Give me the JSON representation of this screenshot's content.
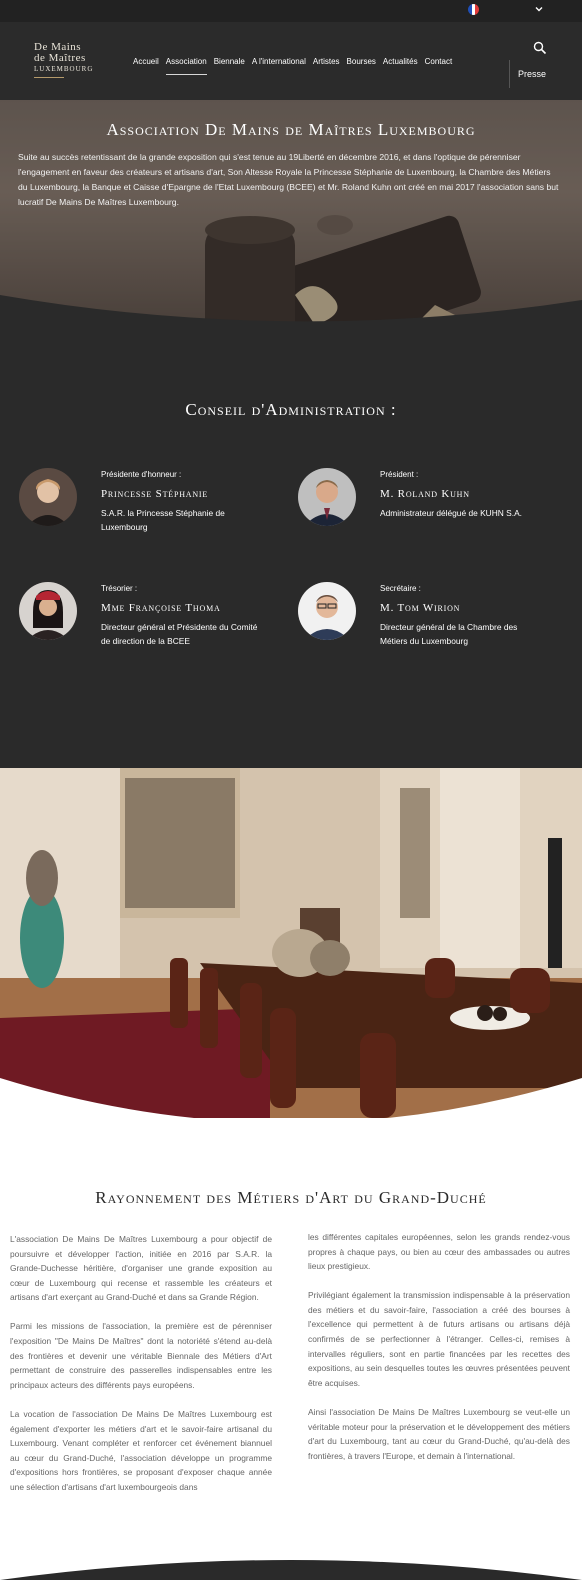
{
  "topbar": {
    "language_flag": "french-flag-icon",
    "dropdown_icon": "chevron-down-icon"
  },
  "header": {
    "logo": {
      "line1": "De Mains",
      "line2": "de Maîtres",
      "line3": "LUXEMBOURG"
    },
    "nav": [
      "Accueil",
      "Association",
      "Biennale",
      "A l'international",
      "Artistes",
      "Bourses",
      "Actualités",
      "Contact"
    ],
    "active_nav": "Association",
    "search_icon": "search-icon",
    "presse_label": "Presse"
  },
  "hero": {
    "title": "Association De Mains de Maîtres Luxembourg",
    "text": "Suite au succès retentissant de la grande exposition qui s'est tenue au 19Liberté en décembre 2016, et dans l'optique de pérenniser l'engagement en faveur des  créateurs et artisans d'art, Son Altesse Royale la Princesse Stéphanie de Luxembourg, la Chambre des Métiers du Luxembourg, la Banque et Caisse d'Epargne de l'Etat Luxembourg (BCEE) et Mr. Roland Kuhn ont créé en mai 2017 l'association sans but lucratif De Mains De Maîtres Luxembourg."
  },
  "board": {
    "title": "Conseil d'Administration :",
    "members": [
      {
        "role": "Présidente d'honneur :",
        "name": "Princesse Stéphanie",
        "desc": "S.A.R. la Princesse Stéphanie de Luxembourg"
      },
      {
        "role": "Président :",
        "name": "M. Roland Kuhn",
        "desc": "Administrateur délégué de KUHN S.A."
      },
      {
        "role": "Trésorier :",
        "name": "Mme Françoise Thoma",
        "desc": "Directeur général et Présidente du Comité de direction de la BCEE"
      },
      {
        "role": "Secrétaire :",
        "name": "M. Tom Wirion",
        "desc": "Directeur général de la Chambre des Métiers du Luxembourg"
      }
    ]
  },
  "rayonnement": {
    "title": "Rayonnement des Métiers d'Art du Grand-Duché",
    "left": [
      "L'association De Mains De Maîtres Luxembourg a pour objectif de poursuivre et développer l'action, initiée en 2016 par S.A.R. la Grande-Duchesse héritière, d'organiser une grande exposition au cœur de Luxembourg qui recense et rassemble les créateurs et artisans d'art exerçant au Grand-Duché et dans sa Grande Région.",
      "Parmi les missions de l'association, la première est de pérenniser l'exposition \"De Mains De Maîtres\" dont la notoriété s'étend au-delà des frontières et devenir une véritable Biennale des Métiers d'Art permettant de construire des passerelles indispensables entre les principaux acteurs des différents pays européens.",
      "La vocation de l'association De Mains De Maîtres Luxembourg est également d'exporter les métiers d'art et le savoir-faire artisanal du Luxembourg. Venant compléter et renforcer cet événement biannuel au cœur du Grand-Duché, l'association développe un programme d'expositions hors frontières, se proposant d'exposer chaque année une sélection d'artisans d'art luxembourgeois dans"
    ],
    "right": [
      "les différentes capitales européennes, selon les grands rendez-vous propres à chaque pays, ou bien au cœur des ambassades ou autres lieux prestigieux.",
      "Privilégiant également la transmission indispensable à la préservation des métiers et du savoir-faire, l'association a créé des bourses à l'excellence qui permettent à de futurs artisans ou artisans déjà confirmés de se perfectionner à l'étranger. Celles-ci, remises à intervalles réguliers, sont en partie financées par les recettes des expositions, au sein desquelles toutes les œuvres présentées peuvent être acquises.",
      "Ainsi l'association De Mains De Maîtres Luxembourg se veut-elle un véritable moteur pour la préservation et le développement des métiers d'art du Luxembourg, tant au cœur du Grand-Duché, qu'au-delà des frontières, à travers l'Europe, et demain à l'international."
    ]
  },
  "colors": {
    "dark_bg": "#2a2a2a",
    "header_bg": "#2b2b2b",
    "accent": "#b59a6a",
    "body_text": "#666666"
  }
}
